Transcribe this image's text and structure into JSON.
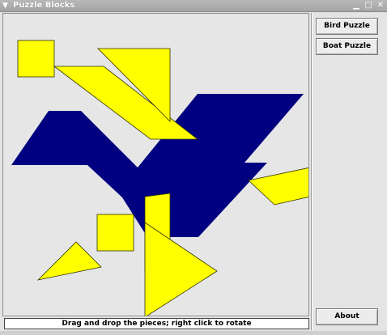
{
  "window": {
    "title": "Puzzle Blocks",
    "controls": {
      "minimize": "▁",
      "maximize": "□",
      "close": "✕"
    }
  },
  "sidebar": {
    "bird_button": "Bird Puzzle",
    "boat_button": "Boat Puzzle",
    "about_button": "About"
  },
  "status_bar": {
    "text": "Drag and drop the pieces; right click to rotate"
  },
  "colors": {
    "target_shape": "#000080",
    "pieces": "#ffff00",
    "piece_outline": "#333300",
    "canvas_background": "#e6e6e6"
  }
}
